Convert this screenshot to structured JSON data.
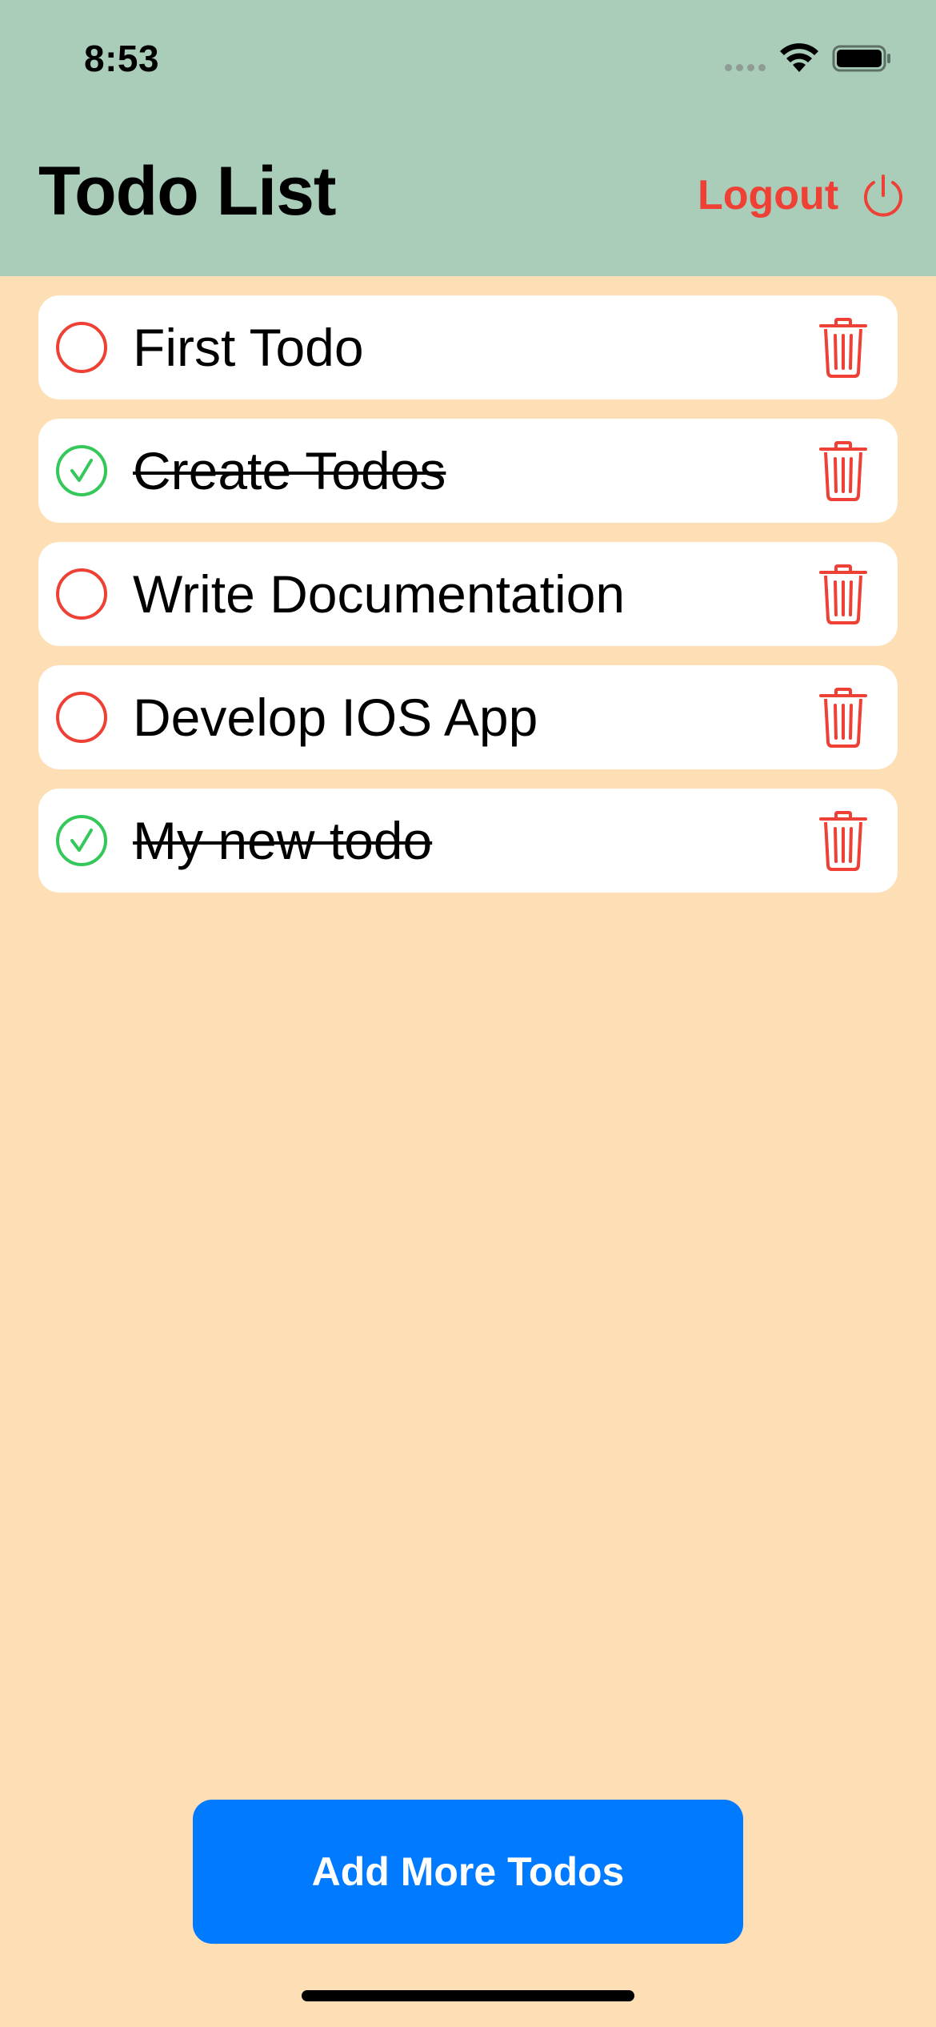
{
  "status_bar": {
    "time": "8:53"
  },
  "header": {
    "title": "Todo List",
    "logout_label": "Logout"
  },
  "colors": {
    "header_bg": "#AACDBA",
    "page_bg": "#FEDEB4",
    "accent_red": "#EE4034",
    "done_green": "#34C759",
    "button_blue": "#007AFF"
  },
  "todos": [
    {
      "text": "First Todo",
      "done": false
    },
    {
      "text": "Create Todos",
      "done": true
    },
    {
      "text": "Write Documentation",
      "done": false
    },
    {
      "text": "Develop IOS App",
      "done": false
    },
    {
      "text": "My new todo",
      "done": true
    }
  ],
  "add_button": {
    "label": "Add More Todos"
  },
  "icons": {
    "incomplete": "empty-circle-icon",
    "complete": "check-circle-icon",
    "delete": "trash-icon",
    "logout": "power-icon"
  }
}
